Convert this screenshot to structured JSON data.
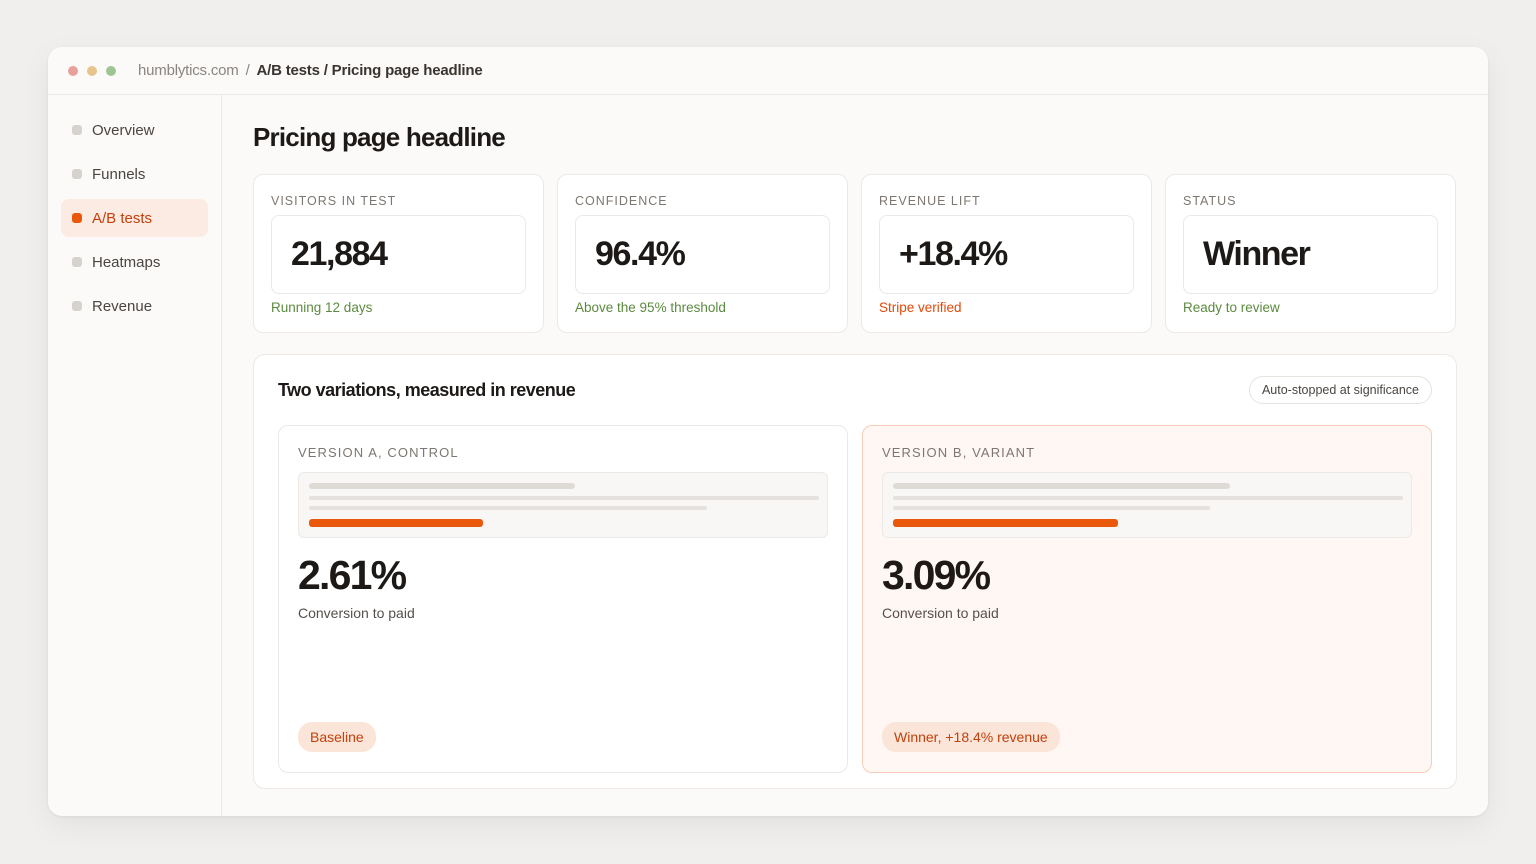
{
  "window": {
    "dots": [
      "#e8a09a",
      "#e8c48d",
      "#9fc493"
    ],
    "url_domain": "humblytics.com",
    "url_separator": "/",
    "url_path": "A/B tests / Pricing page headline"
  },
  "sidebar": {
    "items": [
      {
        "label": "Overview",
        "active": false
      },
      {
        "label": "Funnels",
        "active": false
      },
      {
        "label": "A/B tests",
        "active": true
      },
      {
        "label": "Heatmaps",
        "active": false
      },
      {
        "label": "Revenue",
        "active": false
      }
    ]
  },
  "page": {
    "title": "Pricing page headline"
  },
  "kpis": [
    {
      "label": "VISITORS IN TEST",
      "value": "21,884",
      "sub": "Running 12 days",
      "sub_color": "green"
    },
    {
      "label": "CONFIDENCE",
      "value": "96.4%",
      "sub": "Above the 95% threshold",
      "sub_color": "green"
    },
    {
      "label": "REVENUE LIFT",
      "value": "+18.4%",
      "sub": "Stripe verified",
      "sub_color": "orange"
    },
    {
      "label": "STATUS",
      "value": "Winner",
      "sub": "Ready to review",
      "sub_color": "green"
    }
  ],
  "panel": {
    "title": "Two variations, measured in revenue",
    "tag": "Auto-stopped at significance",
    "variants": [
      {
        "label": "VERSION A, CONTROL",
        "rate": "2.61%",
        "caption": "Conversion to paid",
        "badge": "Baseline",
        "winner": false,
        "cta_fill": 0.34
      },
      {
        "label": "VERSION B, VARIANT",
        "rate": "3.09%",
        "caption": "Conversion to paid",
        "badge": "Winner, +18.4% revenue",
        "winner": true,
        "cta_fill": 0.44
      }
    ]
  },
  "colors": {
    "accent": "#ea580c",
    "accent_text": "#c2410c",
    "positive": "#5b8a3f"
  }
}
